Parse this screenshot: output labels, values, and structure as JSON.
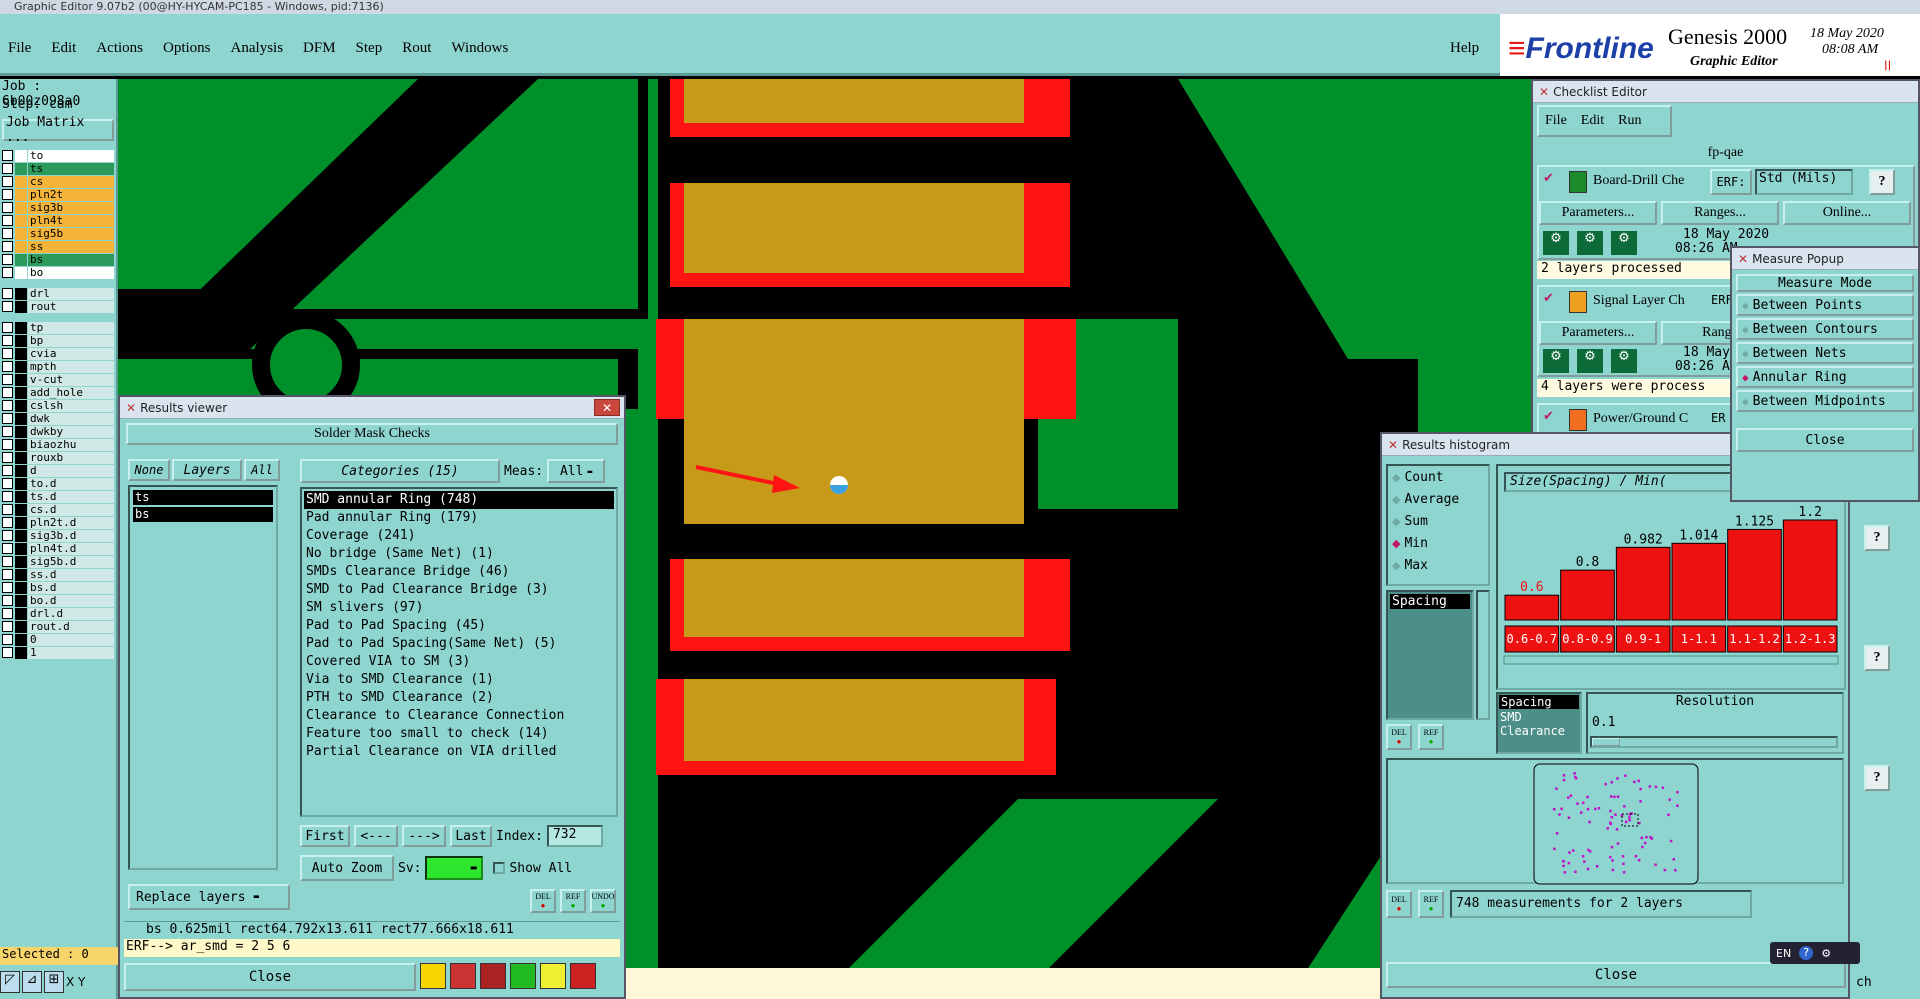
{
  "os_title": "Graphic Editor 9.07b2 (00@HY-HYCAM-PC185 - Windows, pid:7136)",
  "menu": [
    "File",
    "Edit",
    "Actions",
    "Options",
    "Analysis",
    "DFM",
    "Step",
    "Rout",
    "Windows"
  ],
  "help": "Help",
  "brand": {
    "logo": "Frontline",
    "product": "Genesis 2000",
    "subtitle": "Graphic Editor",
    "date": "18 May 2020",
    "time": "08:08 AM"
  },
  "left": {
    "job": "Job : 6b00z098a0",
    "step": "Step: cam",
    "job_matrix": "Job Matrix ...",
    "selected": "Selected : 0",
    "xy": "X Y",
    "layers_a": [
      {
        "n": "to",
        "c": "#ffffff"
      },
      {
        "n": "ts",
        "c": "#2d9a5c"
      },
      {
        "n": "cs",
        "c": "#f4b43a"
      },
      {
        "n": "pln2t",
        "c": "#f4b43a"
      },
      {
        "n": "sig3b",
        "c": "#f4b43a"
      },
      {
        "n": "pln4t",
        "c": "#f4b43a"
      },
      {
        "n": "sig5b",
        "c": "#f4b43a"
      },
      {
        "n": "ss",
        "c": "#f4b43a"
      },
      {
        "n": "bs",
        "c": "#2d9a5c"
      },
      {
        "n": "bo",
        "c": "#ffffff"
      }
    ],
    "layers_b": [
      "drl",
      "rout"
    ],
    "layers_c": [
      "tp",
      "bp",
      "cvia",
      "mpth",
      "v-cut",
      "add_hole",
      "cslsh",
      "dwk",
      "dwkby",
      "biaozhu",
      "rouxb",
      "d",
      "to.d",
      "ts.d",
      "cs.d",
      "pln2t.d",
      "sig3b.d",
      "pln4t.d",
      "sig5b.d",
      "ss.d",
      "bs.d",
      "bo.d",
      "drl.d",
      "rout.d",
      "0",
      "1"
    ]
  },
  "results": {
    "title": "Results viewer",
    "header": "Solder Mask Checks",
    "none": "None",
    "layers": "Layers",
    "all": "All",
    "categories": "Categories (15)",
    "meas": "Meas:",
    "meas_val": "All",
    "layer_list": [
      "ts",
      "bs"
    ],
    "cats": [
      "SMD annular Ring (748)",
      "Pad annular Ring (179)",
      "Coverage (241)",
      "No bridge (Same Net) (1)",
      "SMDs Clearance Bridge (46)",
      "SMD to Pad Clearance Bridge (3)",
      "SM slivers (97)",
      "Pad to Pad Spacing (45)",
      "Pad to Pad Spacing(Same Net) (5)",
      "Covered VIA to SM (3)",
      "Via to SMD Clearance (1)",
      "PTH to SMD Clearance (2)",
      "Clearance to Clearance Connection",
      "Feature too small to check (14)",
      "Partial Clearance on VIA drilled"
    ],
    "first": "First",
    "prev": "<---",
    "next": "--->",
    "last": "Last",
    "index_label": "Index:",
    "index": "732",
    "auto_zoom": "Auto Zoom",
    "sv": "Sv:",
    "show_all": "Show All",
    "replace": "Replace layers",
    "del": "DEL",
    "ref": "REF",
    "undo": "UNDO",
    "info": "bs 0.625mil   rect64.792x13.611   rect77.666x18.611",
    "erf": "ERF--> ar_smd = 2 5 6",
    "close": "Close"
  },
  "checklist": {
    "title": "Checklist Editor",
    "menu": [
      "File",
      "Edit",
      "Run"
    ],
    "name": "fp-qae",
    "items": [
      {
        "name": "Board-Drill Che",
        "erf": "ERF:",
        "erf_val": "Std (Mils)",
        "params": "Parameters...",
        "ranges": "Ranges...",
        "online": "Online...",
        "date": "18 May 2020",
        "time": "08:26 AM",
        "status": "2 layers processed"
      },
      {
        "name": "Signal Layer Ch",
        "erf": "ERF",
        "params": "Parameters...",
        "ranges": "Range",
        "date": "18 May",
        "time": "08:26 AM",
        "status": "4 layers were process"
      },
      {
        "name": "Power/Ground C",
        "erf": "ER"
      }
    ]
  },
  "measure": {
    "title": "Measure Popup",
    "mode": "Measure Mode",
    "options": [
      "Between Points",
      "Between Contours",
      "Between Nets",
      "Annular Ring",
      "Between Midpoints"
    ],
    "selected": 3,
    "close": "Close"
  },
  "histogram": {
    "title": "Results histogram",
    "stats": [
      "Count",
      "Average",
      "Sum",
      "Min",
      "Max"
    ],
    "selected_stat": 3,
    "chart_title": "Size(Spacing) / Min(",
    "list": [
      "Spacing"
    ],
    "list2": [
      "Spacing",
      "SMD",
      "Clearance"
    ],
    "resolution": "Resolution",
    "resolution_val": "0.1",
    "del": "DEL",
    "ref": "REF",
    "footer": "748 measurements for 2 layers",
    "close": "Close"
  },
  "chart_data": {
    "type": "bar",
    "title": "Size(Spacing) / Min(",
    "categories": [
      "0.6-0.7",
      "0.8-0.9",
      "0.9-1",
      "1-1.1",
      "1.1-1.2",
      "1.2-1.3"
    ],
    "values": [
      0.6,
      0.8,
      0.982,
      1.014,
      1.125,
      1.2
    ],
    "labels": [
      "0.6",
      "0.8",
      "0.982",
      "1.014",
      "1.125",
      "1.2"
    ],
    "colors": {
      "bar": "#ee1111",
      "first_label": "#ee1111"
    }
  },
  "tray": {
    "lang": "EN",
    "help": "?",
    "ch": "ch"
  },
  "colors": {
    "canvas": "#00902a",
    "pad": "#c79a19",
    "mask": "#ff1414",
    "panel": "#8fd5cf"
  }
}
